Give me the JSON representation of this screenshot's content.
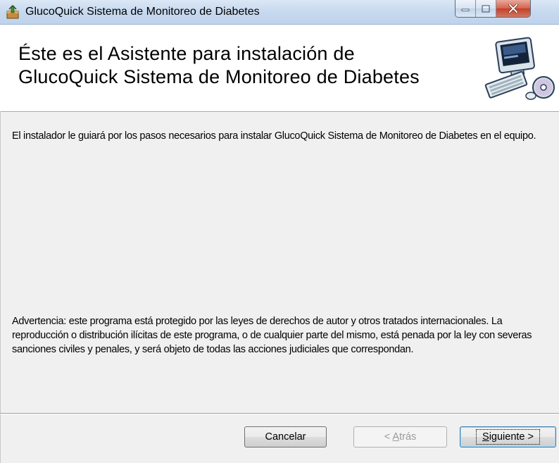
{
  "window": {
    "title": "GlucoQuick Sistema de Monitoreo de Diabetes",
    "icons": [
      "installer-icon",
      "minimize-icon",
      "maximize-icon",
      "close-icon"
    ]
  },
  "header": {
    "title_line1": "Éste es el Asistente para instalación de",
    "title_line2": "GlucoQuick Sistema de Monitoreo de Diabetes",
    "art_icon": "computer-setup-icon"
  },
  "body": {
    "description": "El instalador le guiará por los pasos necesarios para instalar GlucoQuick Sistema de Monitoreo de Diabetes en el equipo.",
    "warning": "Advertencia: este programa está protegido por las leyes de derechos de autor y otros tratados internacionales. La reproducción o distribución ilícitas de este programa, o de cualquier parte del mismo, está penada por la ley con severas sanciones civiles y penales, y será objeto de todas las acciones judiciales que correspondan."
  },
  "buttons": {
    "cancel": "Cancelar",
    "back_prefix": "< ",
    "back_accel": "A",
    "back_rest": "trás",
    "next_accel": "S",
    "next_rest": "iguiente >"
  },
  "colors": {
    "titlebar": "#c5d8ef",
    "close_button": "#c1412a",
    "dialog_bg": "#f0f0f0"
  }
}
